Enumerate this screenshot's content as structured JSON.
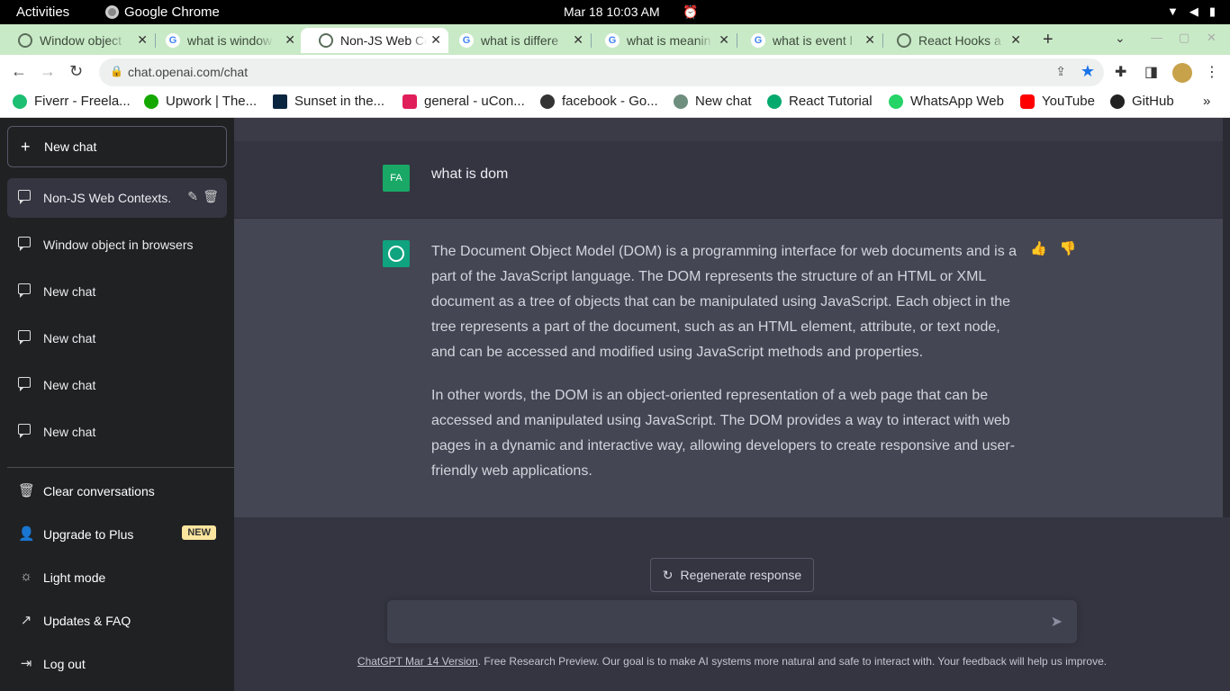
{
  "system": {
    "activities": "Activities",
    "app_name": "Google Chrome",
    "clock": "Mar 18  10:03 AM"
  },
  "tabs": [
    {
      "title": "Window object",
      "icon": "openai-icon"
    },
    {
      "title": "what is window",
      "icon": "google-icon"
    },
    {
      "title": "Non-JS Web Co",
      "icon": "openai-icon"
    },
    {
      "title": "what is differe",
      "icon": "google-icon"
    },
    {
      "title": "what is meanin",
      "icon": "google-icon"
    },
    {
      "title": "what is event l",
      "icon": "google-icon"
    },
    {
      "title": "React Hooks a",
      "icon": "openai-icon"
    }
  ],
  "address": {
    "url": "chat.openai.com/chat"
  },
  "bookmarks": [
    {
      "label": "Fiverr - Freela...",
      "color": "#1dbf73"
    },
    {
      "label": "Upwork | The...",
      "color": "#14a800"
    },
    {
      "label": "Sunset in the...",
      "color": "#0a2540"
    },
    {
      "label": "general - uCon...",
      "color": "#e01e5a"
    },
    {
      "label": "facebook - Go...",
      "color": "#333333"
    },
    {
      "label": "New chat",
      "color": "#6e8e7e"
    },
    {
      "label": "React Tutorial",
      "color": "#04aa6d"
    },
    {
      "label": "WhatsApp Web",
      "color": "#25d366"
    },
    {
      "label": "YouTube",
      "color": "#ff0000"
    },
    {
      "label": "GitHub",
      "color": "#222222"
    }
  ],
  "sidebar": {
    "new_chat": "New chat",
    "conversations": [
      {
        "label": "Non-JS Web Contexts.",
        "active": true
      },
      {
        "label": "Window object in browsers"
      },
      {
        "label": "New chat"
      },
      {
        "label": "New chat"
      },
      {
        "label": "New chat"
      },
      {
        "label": "New chat"
      }
    ],
    "bottom": {
      "clear": "Clear conversations",
      "upgrade": "Upgrade to Plus",
      "upgrade_badge": "NEW",
      "light_mode": "Light mode",
      "updates": "Updates & FAQ",
      "logout": "Log out"
    }
  },
  "chat": {
    "user_initials": "FA",
    "user_message": "what is dom",
    "ai_paragraph_1": "The Document Object Model (DOM) is a programming interface for web documents and is a part of the JavaScript language. The DOM represents the structure of an HTML or XML document as a tree of objects that can be manipulated using JavaScript. Each object in the tree represents a part of the document, such as an HTML element, attribute, or text node, and can be accessed and modified using JavaScript methods and properties.",
    "ai_paragraph_2": "In other words, the DOM is an object-oriented representation of a web page that can be accessed and manipulated using JavaScript. The DOM provides a way to interact with web pages in a dynamic and interactive way, allowing developers to create responsive and user-friendly web applications.",
    "regenerate": "Regenerate response",
    "input_placeholder": ""
  },
  "footer": {
    "version_link": "ChatGPT Mar 14 Version",
    "text": ". Free Research Preview. Our goal is to make AI systems more natural and safe to interact with. Your feedback will help us improve."
  }
}
